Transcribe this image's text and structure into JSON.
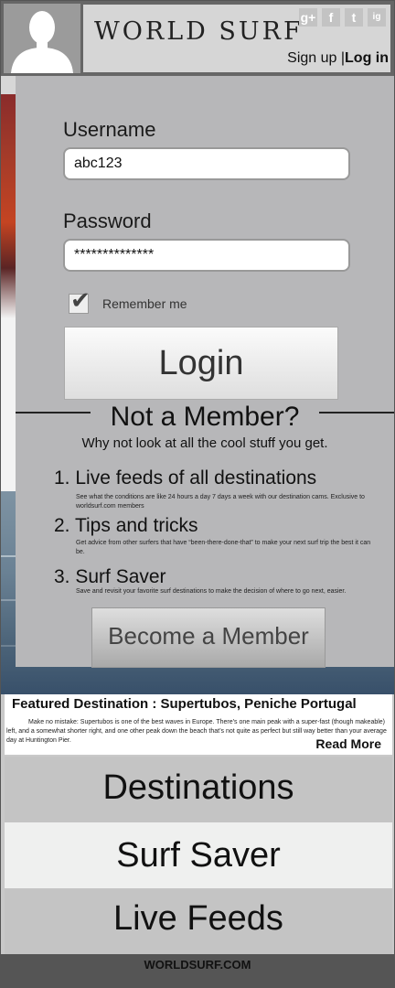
{
  "header": {
    "logo": "WORLD SURF",
    "social": [
      "g+",
      "f",
      "t",
      "ig"
    ],
    "sign_up": "Sign up |",
    "log_in": "Log in"
  },
  "login": {
    "username_label": "Username",
    "username_value": "abc123",
    "password_label": "Password",
    "password_value": "**************",
    "remember_label": "Remember me",
    "remember_checked": true,
    "login_button": "Login"
  },
  "member": {
    "title": "Not a Member?",
    "subtitle": "Why not look at all the cool stuff you get.",
    "features": [
      {
        "title": "1. Live feeds of all destinations",
        "desc": "See what the conditions are like 24 hours a day 7 days a week with our destination cams. Exclusive to worldsurf.com members"
      },
      {
        "title": "2. Tips and tricks",
        "desc": "Get advice from other surfers that have “been-there-done-that” to make your next surf trip the best it can be."
      },
      {
        "title": "3. Surf Saver",
        "desc": "Save and revisit your favorite surf destinations to make the decision of where to go next, easier."
      }
    ],
    "button": "Become a Member"
  },
  "featured": {
    "heading": "Featured Destination : Supertubos, Peniche Portugal",
    "body": "Make no mistake: Supertubos is one of the best waves in Europe. There’s one main peak with a super-fast (though makeable) left, and a somewhat shorter right, and one other peak down the beach that’s not quite as perfect but still way better than your average day at Huntington Pier.",
    "read_more": "Read More"
  },
  "nav": [
    "Destinations",
    "Surf Saver",
    "Live Feeds"
  ],
  "footer": "WORLDSURF.COM",
  "colors": {
    "panel": "#b7b7b9",
    "header": "#666666",
    "nav_active": "#eff0ef"
  }
}
